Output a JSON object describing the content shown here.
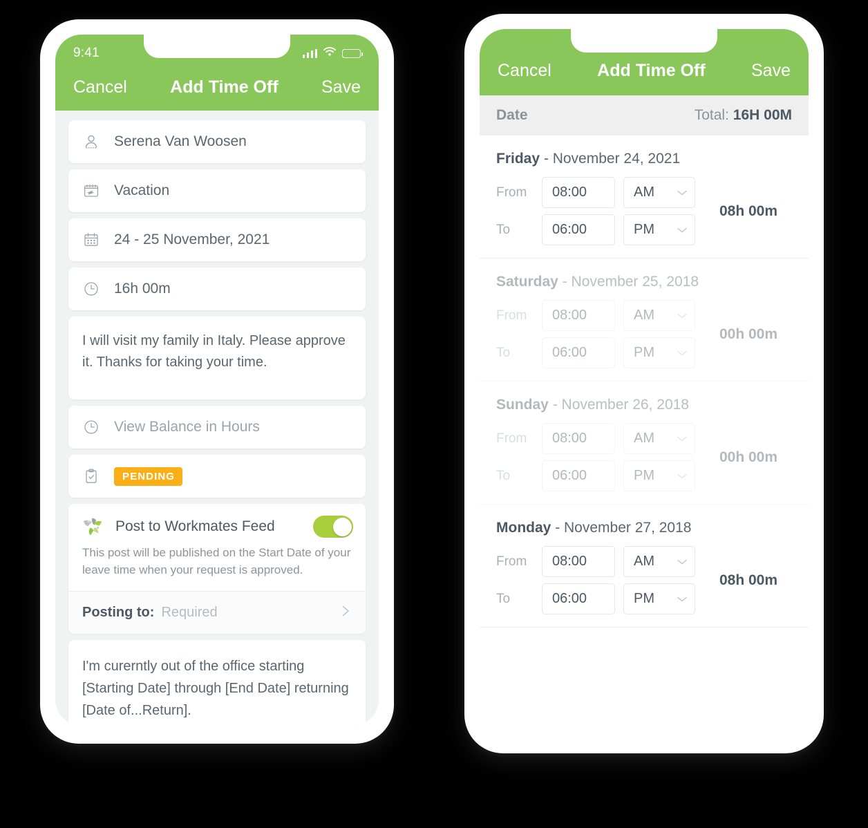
{
  "colors": {
    "brand_green": "#8AC75A",
    "toggle_green": "#A9CE3C",
    "badge_orange": "#FBAF17",
    "text_dark": "#4C5863",
    "text_muted": "#9AA4AD"
  },
  "left_phone": {
    "status_bar": {
      "time": "9:41",
      "icons": [
        "signal-bars-icon",
        "wifi-icon",
        "battery-icon"
      ]
    },
    "navbar": {
      "cancel": "Cancel",
      "title": "Add Time Off",
      "save": "Save"
    },
    "rows": [
      {
        "icon": "person-icon",
        "text": "Serena Van Woosen"
      },
      {
        "icon": "vacation-plane-icon",
        "text": "Vacation"
      },
      {
        "icon": "calendar-icon",
        "text": "24 - 25 November, 2021"
      },
      {
        "icon": "clock-icon",
        "text": "16h 00m"
      }
    ],
    "note": "I will visit my family in Italy. Please approve it. Thanks for taking your time.",
    "balance": {
      "icon": "clock-icon",
      "text": "View Balance in Hours"
    },
    "status": {
      "icon": "clipboard-check-icon",
      "badge": "PENDING"
    },
    "workmates": {
      "logo": "workmates-logo-icon",
      "title": "Post to Workmates Feed",
      "toggle_state": "on",
      "description": "This post will be published on the Start Date of your leave time when your request is approved.",
      "posting_label": "Posting to:",
      "posting_value": "Required",
      "chevron": "chevron-right-icon"
    },
    "template_message": "I'm curerntly out of the office starting [Starting Date] through [End Date] returning [Date of...Return]."
  },
  "right_phone": {
    "navbar": {
      "cancel": "Cancel",
      "title": "Add Time Off",
      "save": "Save"
    },
    "date_bar": {
      "label": "Date",
      "total_label": "Total:",
      "total_value": "16H 00M"
    },
    "labels": {
      "from": "From",
      "to": "To"
    },
    "days": [
      {
        "weekday": "Friday",
        "date": "- November 24, 2021",
        "enabled": true,
        "from_time": "08:00",
        "from_period": "AM",
        "to_time": "06:00",
        "to_period": "PM",
        "total": "08h 00m"
      },
      {
        "weekday": "Saturday",
        "date": "- November 25, 2018",
        "enabled": false,
        "from_time": "08:00",
        "from_period": "AM",
        "to_time": "06:00",
        "to_period": "PM",
        "total": "00h 00m"
      },
      {
        "weekday": "Sunday",
        "date": "- November 26, 2018",
        "enabled": false,
        "from_time": "08:00",
        "from_period": "AM",
        "to_time": "06:00",
        "to_period": "PM",
        "total": "00h 00m"
      },
      {
        "weekday": "Monday",
        "date": "- November 27, 2018",
        "enabled": true,
        "from_time": "08:00",
        "from_period": "AM",
        "to_time": "06:00",
        "to_period": "PM",
        "total": "08h 00m"
      }
    ]
  }
}
